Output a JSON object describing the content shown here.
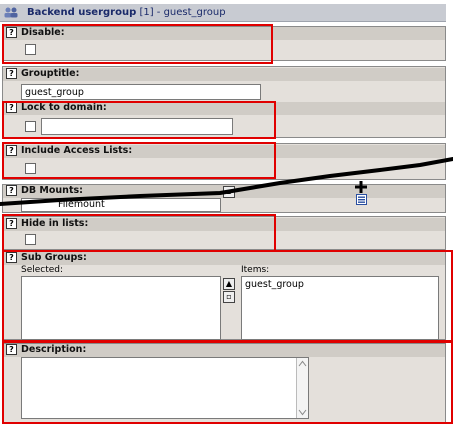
{
  "titlebar": {
    "title": "Backend usergroup",
    "suffix": "[1] - guest_group"
  },
  "sections": {
    "disable": {
      "label": "Disable:"
    },
    "grouptitle": {
      "label": "Grouptitle:",
      "value": "guest_group"
    },
    "lock": {
      "label": "Lock to domain:"
    },
    "include_acl": {
      "label": "Include Access Lists:"
    },
    "db_mounts": {
      "label": "DB Mounts:",
      "value": "Filemount"
    },
    "hide": {
      "label": "Hide in lists:"
    },
    "subgroups": {
      "label": "Sub Groups:",
      "selected_label": "Selected:",
      "items_label": "Items:",
      "items": [
        "guest_group"
      ]
    },
    "description": {
      "label": "Description:"
    }
  },
  "colors": {
    "highlight": "#e00000",
    "section_bg": "#e4e0db",
    "header_bg": "#d0ccc6"
  }
}
